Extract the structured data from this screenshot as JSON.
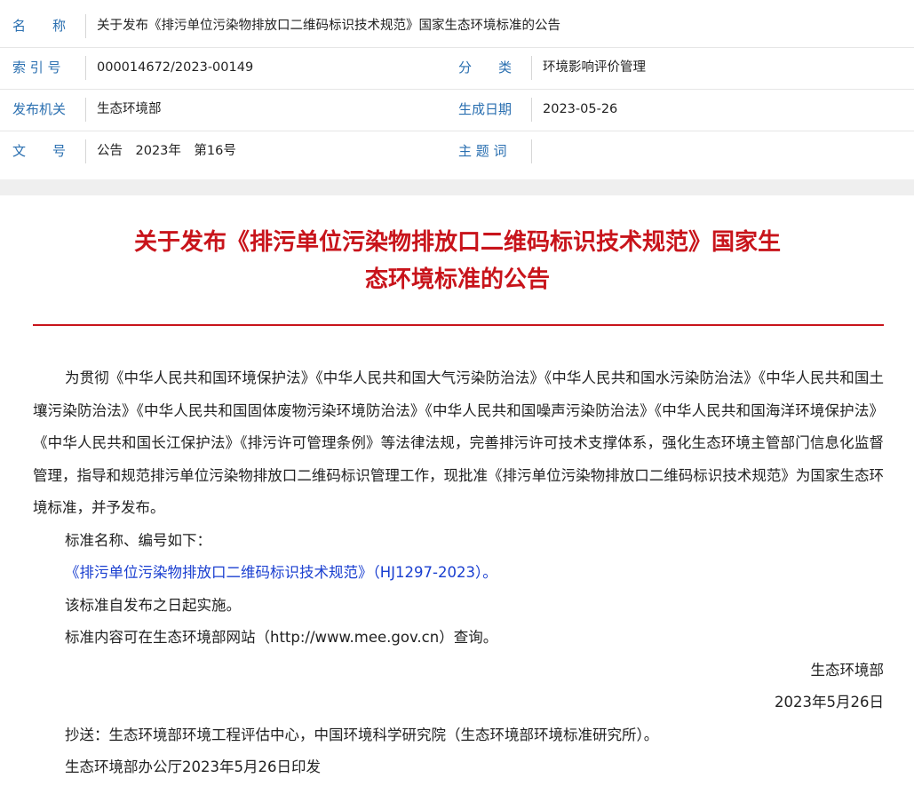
{
  "meta": {
    "name_label": "名　　称",
    "name_value": "关于发布《排污单位污染物排放口二维码标识技术规范》国家生态环境标准的公告",
    "index_label": "索 引 号",
    "index_value": "000014672/2023-00149",
    "category_label": "分　　类",
    "category_value": "环境影响评价管理",
    "issuer_label": "发布机关",
    "issuer_value": "生态环境部",
    "date_label": "生成日期",
    "date_value": "2023-05-26",
    "docno_label": "文　　号",
    "docno_value": "公告　2023年　第16号",
    "subject_label": "主 题 词",
    "subject_value": ""
  },
  "article": {
    "title_line1": "关于发布《排污单位污染物排放口二维码标识技术规范》国家生",
    "title_line2": "态环境标准的公告",
    "para1": "为贯彻《中华人民共和国环境保护法》《中华人民共和国大气污染防治法》《中华人民共和国水污染防治法》《中华人民共和国土壤污染防治法》《中华人民共和国固体废物污染环境防治法》《中华人民共和国噪声污染防治法》《中华人民共和国海洋环境保护法》《中华人民共和国长江保护法》《排污许可管理条例》等法律法规，完善排污许可技术支撑体系，强化生态环境主管部门信息化监督管理，指导和规范排污单位污染物排放口二维码标识管理工作，现批准《排污单位污染物排放口二维码标识技术规范》为国家生态环境标准，并予发布。",
    "line_std_intro": "标准名称、编号如下：",
    "line_std_link": "《排污单位污染物排放口二维码标识技术规范》（HJ1297-2023）。",
    "line_effective": "该标准自发布之日起实施。",
    "line_website": "标准内容可在生态环境部网站（http://www.mee.gov.cn）查询。",
    "signature_org": "生态环境部",
    "signature_date": "2023年5月26日",
    "cc": "抄送：生态环境部环境工程评估中心，中国环境科学研究院（生态环境部环境标准研究所）。",
    "print_line": "生态环境部办公厅2023年5月26日印发"
  },
  "colors": {
    "label_blue": "#2a6fb0",
    "title_red": "#c8141b",
    "link_blue": "#1a3fd0"
  }
}
